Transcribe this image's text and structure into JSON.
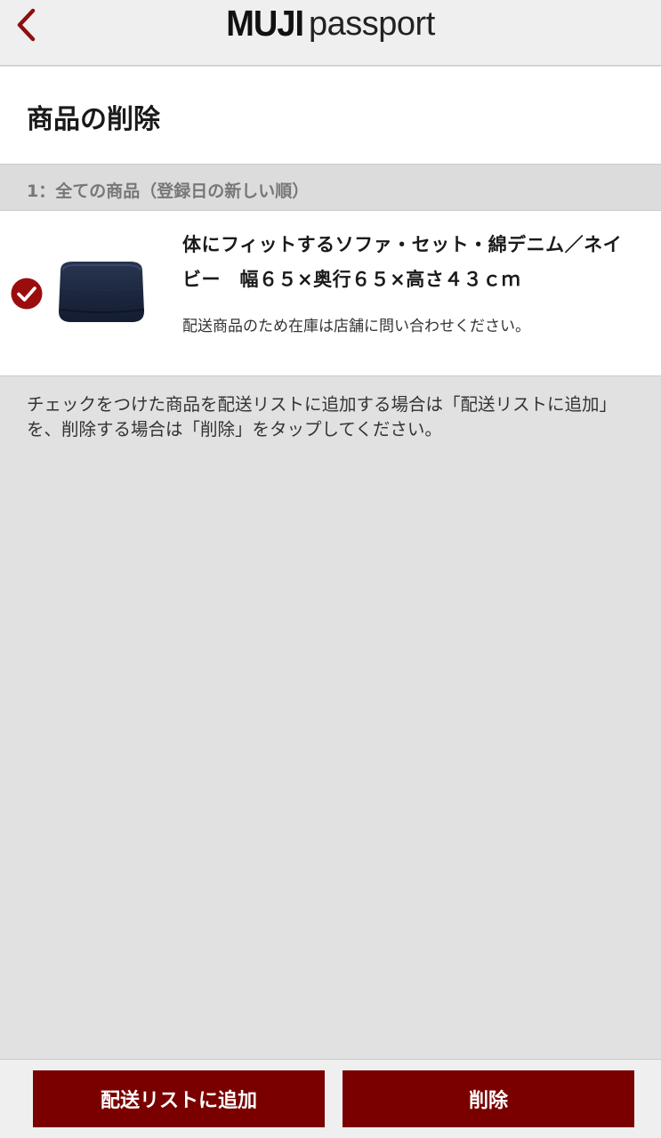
{
  "nav": {
    "logo_bold": "MUJI",
    "logo_light": "passport",
    "back_icon": "chevron-left-icon"
  },
  "page": {
    "title": "商品の削除"
  },
  "section": {
    "header": "1：全ての商品（登録日の新しい順）"
  },
  "product": {
    "checked": true,
    "name_line1": "体にフィットするソファ・セット・綿デニム／ネイ",
    "name_line2": "ビー　幅６５×奥行６５×高さ４３ｃｍ",
    "note": "配送商品のため在庫は店舗に問い合わせください。",
    "image_icon": "sofa-product-image"
  },
  "instruction": {
    "text": "チェックをつけた商品を配送リストに追加する場合は「配送リストに追加」を、削除する場合は「削除」をタップしてください。"
  },
  "buttons": {
    "add_label": "配送リストに追加",
    "delete_label": "削除"
  },
  "colors": {
    "accent": "#7a0000",
    "check": "#9b0d0d",
    "background": "#e1e1e1"
  }
}
